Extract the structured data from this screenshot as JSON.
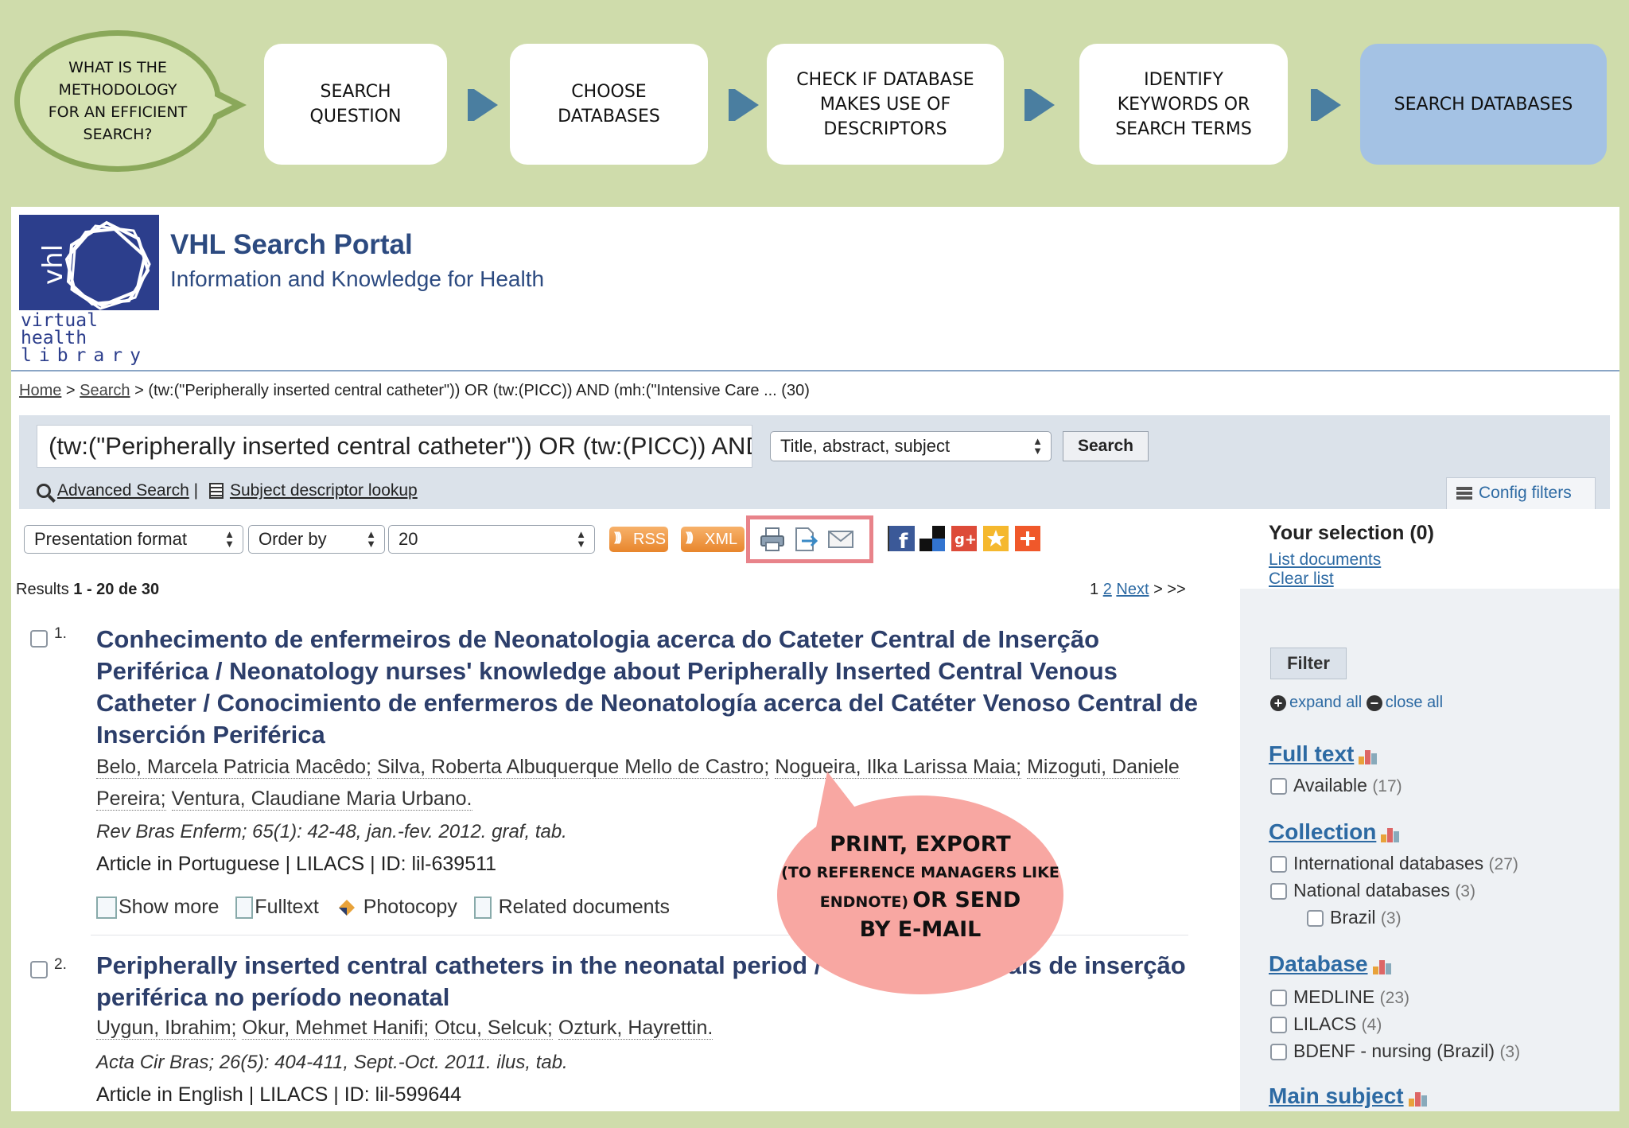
{
  "workflow": {
    "question": "WHAT IS THE METHODOLOGY FOR AN EFFICIENT SEARCH?",
    "steps": [
      {
        "label": "SEARCH QUESTION"
      },
      {
        "label": "CHOOSE DATABASES"
      },
      {
        "label": "CHECK IF DATABASE MAKES USE OF DESCRIPTORS"
      },
      {
        "label": "IDENTIFY KEYWORDS OR SEARCH TERMS"
      },
      {
        "label": "SEARCH DATABASES"
      }
    ]
  },
  "portal": {
    "logo_line1": "virtual health",
    "logo_line2": "library",
    "logo_mark": "vhl",
    "title": "VHL Search Portal",
    "subtitle": "Information and Knowledge for Health"
  },
  "breadcrumb": {
    "home": "Home",
    "separator": ">",
    "search": "Search",
    "current": "> (tw:(\"Peripherally inserted central catheter\")) OR (tw:(PICC)) AND (mh:(\"Intensive Care ... (30)"
  },
  "search": {
    "query": "(tw:(\"Peripherally inserted central catheter\")) OR (tw:(PICC)) AND (mh:(\"Intensive Care",
    "field_select": "Title, abstract, subject",
    "button": "Search",
    "advanced": "Advanced Search",
    "divider": "|",
    "descriptor_lookup": "Subject descriptor lookup",
    "config_filters": "Config filters"
  },
  "toolbar": {
    "presentation": "Presentation format",
    "order": "Order by",
    "per_page": "20",
    "rss": "RSS",
    "xml": "XML"
  },
  "social_colors": {
    "facebook": "#3b5998",
    "google": "#dd4b39",
    "star": "#f5b82e",
    "plus": "#f0582a"
  },
  "results": {
    "count_prefix": "Results",
    "count_range": "1 - 20",
    "count_suffix": "de 30",
    "pager_1": "1",
    "pager_2": "2",
    "pager_next": "Next",
    "pager_end": "> >>",
    "items": [
      {
        "num": "1.",
        "title": "Conhecimento de enfermeiros de Neonatologia acerca do Cateter Central de Inserção Periférica / Neonatology nurses' knowledge about Peripherally Inserted Central Venous Catheter / Conocimiento de enfermeros de Neonatología acerca del Catéter Venoso Central de Inserción Periférica",
        "authors": [
          "Belo, Marcela Patricia Macêdo;",
          "Silva, Roberta Albuquerque Mello de Castro;",
          "Nogueira, Ilka Larissa Maia;",
          "Mizoguti, Daniele Pereira;",
          "Ventura, Claudiane Maria Urbano."
        ],
        "source": "Rev Bras Enferm; 65(1): 42-48, jan.-fev. 2012. graf, tab.",
        "meta": "Article in Portuguese | LILACS | ID: lil-639511",
        "actions": {
          "show_more": "Show more",
          "fulltext": "Fulltext",
          "photocopy": "Photocopy",
          "related": "Related documents"
        }
      },
      {
        "num": "2.",
        "title": "Peripherally inserted central catheters in the neonatal period / Cateteres centrais de inserção periférica no período neonatal",
        "authors": [
          "Uygun, Ibrahim;",
          "Okur, Mehmet Hanifi;",
          "Otcu, Selcuk;",
          "Ozturk, Hayrettin."
        ],
        "source": "Acta Cir Bras; 26(5): 404-411, Sept.-Oct. 2011. ilus, tab.",
        "meta": "Article in English | LILACS | ID: lil-599644"
      }
    ]
  },
  "sidebar": {
    "selection": "Your selection (0)",
    "list_documents": "List documents",
    "clear_list": "Clear list",
    "filter": "Filter",
    "expand_all": "expand all",
    "close_all": "close all",
    "facets": {
      "fulltext": {
        "title": "Full text",
        "items": [
          {
            "label": "Available",
            "count": "(17)"
          }
        ]
      },
      "collection": {
        "title": "Collection",
        "items": [
          {
            "label": "International databases",
            "count": "(27)"
          },
          {
            "label": "National databases",
            "count": "(3)"
          },
          {
            "label": "Brazil",
            "count": "(3)"
          }
        ]
      },
      "database": {
        "title": "Database",
        "items": [
          {
            "label": "MEDLINE",
            "count": "(23)"
          },
          {
            "label": "LILACS",
            "count": "(4)"
          },
          {
            "label": "BDENF - nursing (Brazil)",
            "count": "(3)"
          }
        ]
      },
      "main_subject": {
        "title": "Main subject"
      }
    }
  },
  "callout": {
    "line1": "PRINT, EXPORT",
    "line2": "(TO REFERENCE MANAGERS LIKE",
    "line3a": "ENDNOTE)",
    "line3b": "OR SEND",
    "line4": "BY E-MAIL"
  }
}
